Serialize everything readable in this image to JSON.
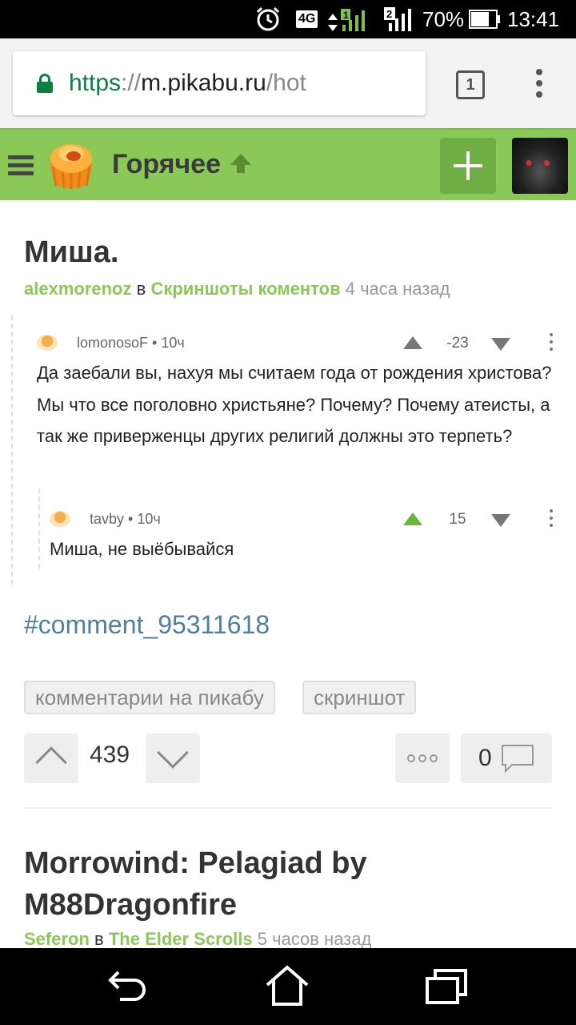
{
  "status_bar": {
    "network": "4G",
    "sim1": "1",
    "sim2": "2",
    "battery": "70%",
    "time": "13:41"
  },
  "browser": {
    "url_scheme": "https",
    "url_sep": "://",
    "url_host": "m.pikabu.ru",
    "url_path": "/hot",
    "tab_count": "1"
  },
  "header": {
    "title": "Горячее",
    "accent_color": "#8ac858"
  },
  "post": {
    "title": "Миша.",
    "author": "alexmorenoz",
    "in_word": "в",
    "community": "Скриншоты коментов",
    "time": "4 часа назад",
    "comments": [
      {
        "user": "lomonosoF • 10ч",
        "score": "-23",
        "text": "Да заебали вы, нахуя мы считаем года от рождения христова? Мы что все поголовно христьяне? Почему? Почему атеисты, а так же приверженцы других религий должны это терпеть?"
      },
      {
        "user": "tavby • 10ч",
        "score": "15",
        "text": "Миша, не выёбывайся"
      }
    ],
    "link": "#comment_95311618",
    "tags": [
      "комментарии на пикабу",
      "скриншот"
    ],
    "rating": "439",
    "comments_count": "0"
  },
  "next_post": {
    "title": "Morrowind: Pelagiad by M88Dragonfire",
    "author": "Seferon",
    "in_word": "в",
    "community": "The Elder Scrolls",
    "time": "5 часов назад"
  }
}
